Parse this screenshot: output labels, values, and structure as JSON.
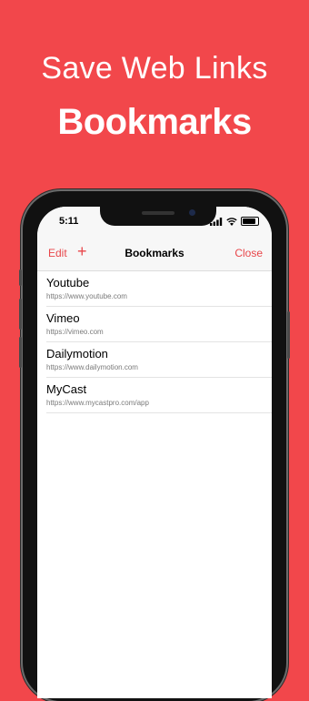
{
  "promo": {
    "title": "Save Web Links",
    "heading": "Bookmarks"
  },
  "status_bar": {
    "time": "5:11"
  },
  "nav": {
    "edit_label": "Edit",
    "add_label": "+",
    "title": "Bookmarks",
    "close_label": "Close"
  },
  "bookmarks": [
    {
      "title": "Youtube",
      "url": "https://www.youtube.com"
    },
    {
      "title": "Vimeo",
      "url": "https://vimeo.com"
    },
    {
      "title": "Dailymotion",
      "url": "https://www.dailymotion.com"
    },
    {
      "title": "MyCast",
      "url": "https://www.mycastpro.com/app"
    }
  ],
  "colors": {
    "background": "#f2474b",
    "accent": "#e8464a"
  },
  "icons": [
    "signal-icon",
    "wifi-icon",
    "battery-icon"
  ]
}
